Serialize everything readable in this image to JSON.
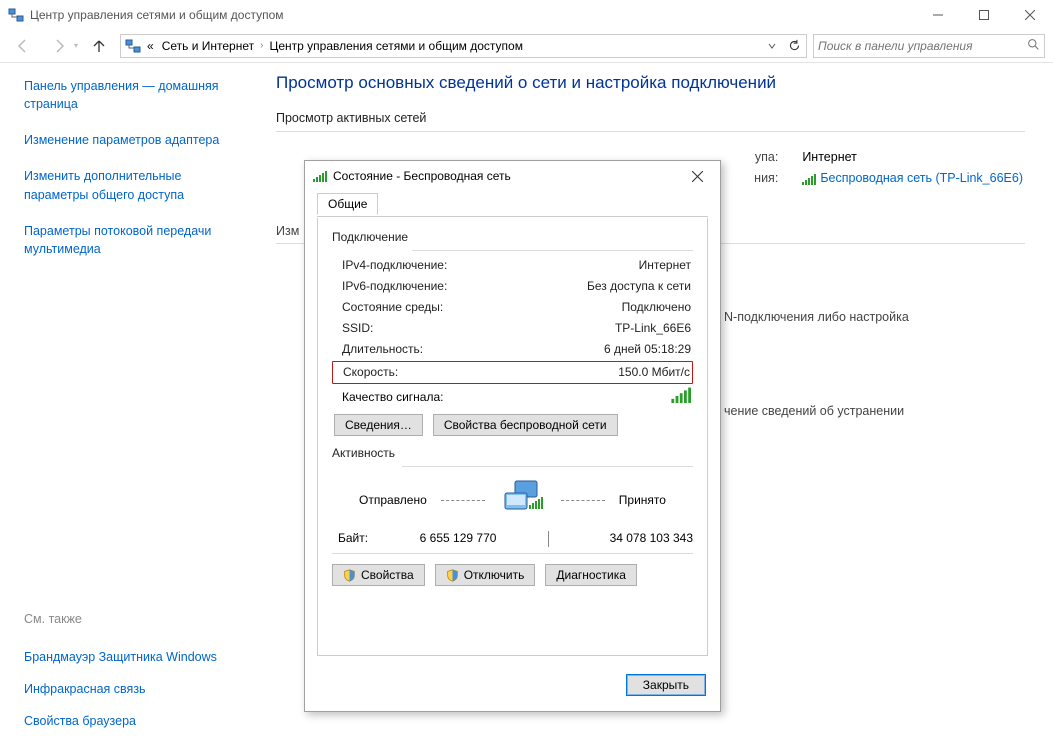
{
  "window": {
    "title": "Центр управления сетями и общим доступом",
    "minimize": "—",
    "maximize": "☐",
    "close": "✕"
  },
  "toolbar": {
    "breadcrumb_prefix": "«",
    "crumb1": "Сеть и Интернет",
    "crumb2": "Центр управления сетями и общим доступом",
    "search_placeholder": "Поиск в панели управления"
  },
  "sidebar": {
    "home": "Панель управления — домашняя страница",
    "items": [
      "Изменение параметров адаптера",
      "Изменить дополнительные параметры общего доступа",
      "Параметры потоковой передачи мультимедиа"
    ],
    "see_also_title": "См. также",
    "see_also": [
      "Брандмауэр Защитника Windows",
      "Инфракрасная связь",
      "Свойства браузера"
    ]
  },
  "main": {
    "heading": "Просмотр основных сведений о сети и настройка подключений",
    "active_networks_title": "Просмотр активных сетей",
    "change_label": "Изм",
    "access_type_label": "упа:",
    "access_type_value": "Интернет",
    "connections_label": "ния:",
    "connections_value": "Беспроводная сеть (TP-Link_66E6)",
    "back1": "N-подключения либо настройка",
    "back2": "чение сведений об устранении"
  },
  "dialog": {
    "title": "Состояние - Беспроводная сеть",
    "close": "✕",
    "tab_general": "Общие",
    "legend_connection": "Подключение",
    "rows": {
      "ipv4_k": "IPv4-подключение:",
      "ipv4_v": "Интернет",
      "ipv6_k": "IPv6-подключение:",
      "ipv6_v": "Без доступа к сети",
      "media_k": "Состояние среды:",
      "media_v": "Подключено",
      "ssid_k": "SSID:",
      "ssid_v": "TP-Link_66E6",
      "dur_k": "Длительность:",
      "dur_v": "6 дней 05:18:29",
      "speed_k": "Скорость:",
      "speed_v": "150.0 Мбит/с",
      "quality_k": "Качество сигнала:"
    },
    "btn_details": "Сведения…",
    "btn_wireless_props": "Свойства беспроводной сети",
    "legend_activity": "Активность",
    "sent_label": "Отправлено",
    "recv_label": "Принято",
    "bytes_label": "Байт:",
    "bytes_sent": "6 655 129 770",
    "bytes_recv": "34 078 103 343",
    "btn_props": "Свойства",
    "btn_disable": "Отключить",
    "btn_diag": "Диагностика",
    "btn_close": "Закрыть"
  }
}
